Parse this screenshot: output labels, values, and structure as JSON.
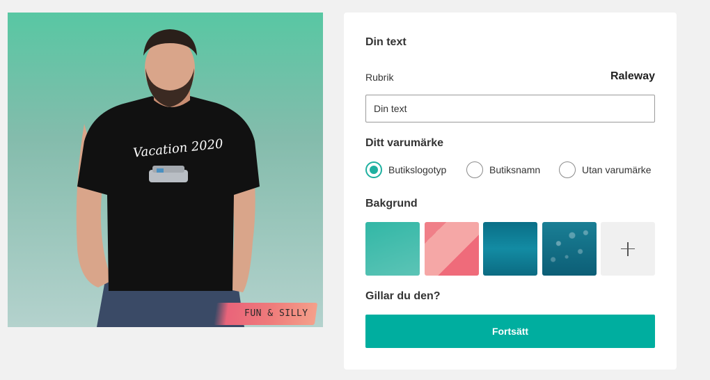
{
  "preview": {
    "design_text": "Vacation 2020",
    "brand_tag": "FUN & SILLY",
    "background_color": "#58c7a3",
    "shirt_color": "#111111"
  },
  "panel": {
    "your_text_heading": "Din text",
    "headline_label": "Rubrik",
    "font_name": "Raleway",
    "text_value": "Din text",
    "brand_heading": "Ditt varumärke",
    "brand_options": [
      {
        "label": "Butikslogotyp",
        "selected": true
      },
      {
        "label": "Butiksnamn",
        "selected": false
      },
      {
        "label": "Utan varumärke",
        "selected": false
      }
    ],
    "background_heading": "Bakgrund",
    "backgrounds": [
      "teal",
      "pink-diagonal",
      "ocean-blue",
      "bokeh-blue",
      "add"
    ],
    "like_heading": "Gillar du den?",
    "continue_label": "Fortsätt"
  },
  "colors": {
    "accent": "#00ae9f",
    "radio_selected": "#1fb0a0",
    "page_bg": "#f1f1f1"
  }
}
